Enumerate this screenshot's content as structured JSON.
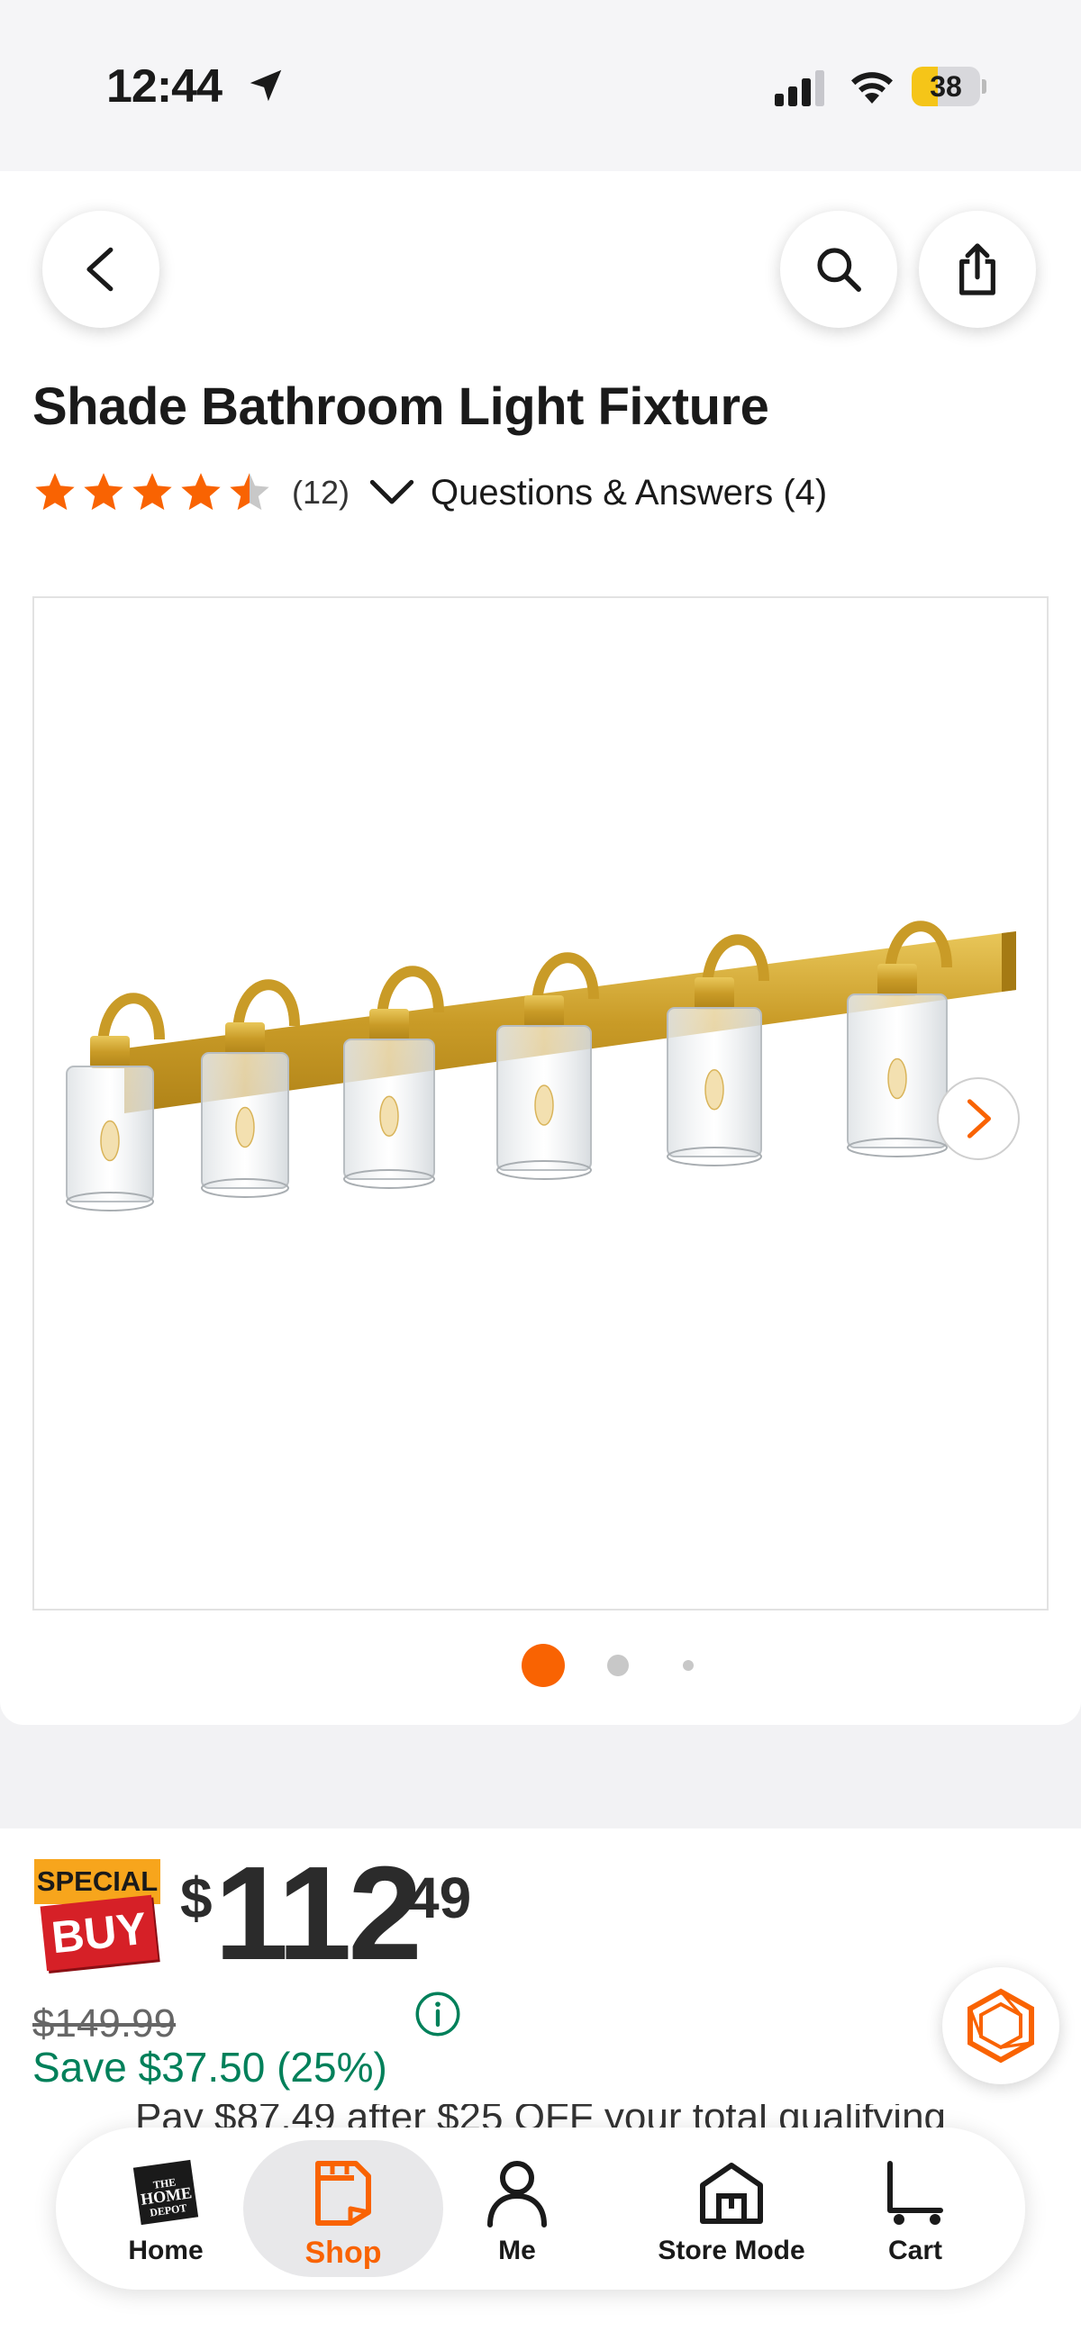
{
  "status_bar": {
    "time": "12:44",
    "battery": "38",
    "battery_level": 0.38
  },
  "header": {
    "back_icon": "chevron-left-icon",
    "search_icon": "search-icon",
    "share_icon": "share-icon"
  },
  "product": {
    "title": "Shade Bathroom Light Fixture",
    "rating": 4.5,
    "rating_max": 5,
    "review_count": "(12)",
    "qa_label": "Questions & Answers (4)",
    "image_count": 3,
    "active_image": 1
  },
  "pricing": {
    "badge_top": "SPECIAL",
    "badge_bottom": "BUY",
    "currency": "$",
    "dollars": "112",
    "cents": "49",
    "was_price": "$149.99",
    "savings": "Save $37.50 (25%)",
    "promo": "Pay $87.49 after $25 OFF your total qualifying"
  },
  "tab_bar": {
    "tabs": [
      {
        "label": "Home",
        "icon": "home-depot-logo-icon"
      },
      {
        "label": "Shop",
        "icon": "shop-icon"
      },
      {
        "label": "Me",
        "icon": "person-icon"
      },
      {
        "label": "Store Mode",
        "icon": "store-icon"
      },
      {
        "label": "Cart",
        "icon": "cart-icon"
      }
    ],
    "active": "Shop"
  },
  "colors": {
    "brand_orange": "#f96302",
    "save_green": "#00805a",
    "special_yellow": "#f7a51c",
    "buy_red": "#d62027",
    "star_orange": "#f96302"
  }
}
